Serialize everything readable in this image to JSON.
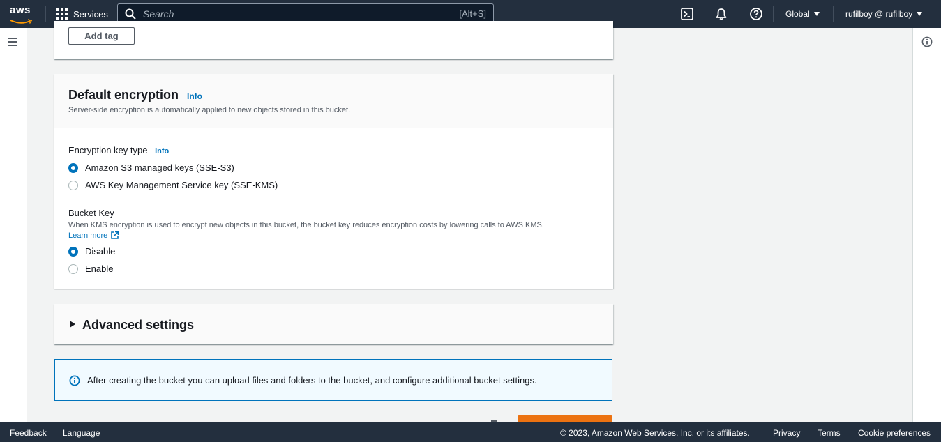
{
  "topnav": {
    "logo_text": "aws",
    "services_label": "Services",
    "search_placeholder": "Search",
    "search_shortcut": "[Alt+S]",
    "region_label": "Global",
    "account_label": "rufilboy @ rufilboy",
    "icons": [
      "cloudshell-icon",
      "bell-icon",
      "help-icon"
    ]
  },
  "tags_section": {
    "add_tag_label": "Add tag"
  },
  "default_encryption": {
    "title": "Default encryption",
    "info_label": "Info",
    "description": "Server-side encryption is automatically applied to new objects stored in this bucket.",
    "key_type_label": "Encryption key type",
    "key_type_info": "Info",
    "key_type_options": [
      {
        "label": "Amazon S3 managed keys (SSE-S3)",
        "selected": true
      },
      {
        "label": "AWS Key Management Service key (SSE-KMS)",
        "selected": false
      }
    ],
    "bucket_key_label": "Bucket Key",
    "bucket_key_description": "When KMS encryption is used to encrypt new objects in this bucket, the bucket key reduces encryption costs by lowering calls to AWS KMS.",
    "learn_more_label": "Learn more",
    "bucket_key_options": [
      {
        "label": "Disable",
        "selected": true
      },
      {
        "label": "Enable",
        "selected": false
      }
    ]
  },
  "advanced_settings": {
    "title": "Advanced settings",
    "expanded": false
  },
  "info_alert": {
    "text": "After creating the bucket you can upload files and folders to the bucket, and configure additional bucket settings."
  },
  "footer": {
    "feedback_label": "Feedback",
    "language_label": "Language",
    "copyright": "© 2023, Amazon Web Services, Inc. or its affiliates.",
    "privacy_label": "Privacy",
    "terms_label": "Terms",
    "cookie_label": "Cookie preferences"
  },
  "colors": {
    "nav_bg": "#232f3e",
    "link": "#0073bb",
    "primary_button": "#ec7211",
    "alert_bg": "#f1faff"
  }
}
